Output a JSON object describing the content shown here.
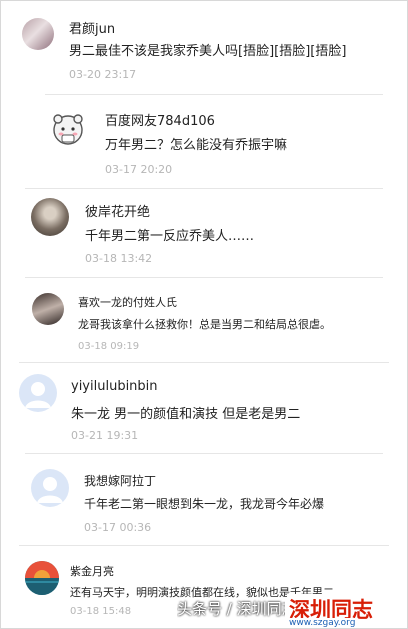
{
  "comments": [
    {
      "user": "君颜jun",
      "text": "男二最佳不该是我家乔美人吗[捂脸][捂脸][捂脸]",
      "time": "03-20 23:17"
    },
    {
      "user": "百度网友784d106",
      "text": "万年男二？怎么能没有乔振宇嘛",
      "time": "03-17 20:20"
    },
    {
      "user": "彼岸花开绝",
      "text": "千年男二第一反应乔美人……",
      "time": "03-18 13:42"
    },
    {
      "user": "喜欢一龙的付姓人氏",
      "text": "龙哥我该拿什么拯救你！总是当男二和结局总很虐。",
      "time": "03-18 09:19"
    },
    {
      "user": "yiyilulubinbin",
      "text": "朱一龙 男一的颜值和演技 但是老是男二",
      "time": "03-21 19:31"
    },
    {
      "user": "我想嫁阿拉丁",
      "text": "千年老二第一眼想到朱一龙，我龙哥今年必爆",
      "time": "03-17 00:36"
    },
    {
      "user": "紫金月亮",
      "text": "还有马天宇，明明演技颜值都在线，貌似也是千年男二",
      "time": "03-18 15:48"
    }
  ],
  "watermark": {
    "source": "头条号 / 深圳同志",
    "brand": "深圳同志",
    "url": "www.szgay.org"
  },
  "colors": {
    "time": "#b6b6b6",
    "text": "#222222",
    "divider": "#e6e6e6",
    "brand_red": "#d81e06",
    "brand_blue": "#1a5fb4"
  },
  "icons": [
    "avatar-photo",
    "avatar-cartoon-bear",
    "avatar-default-person",
    "avatar-sunset"
  ]
}
